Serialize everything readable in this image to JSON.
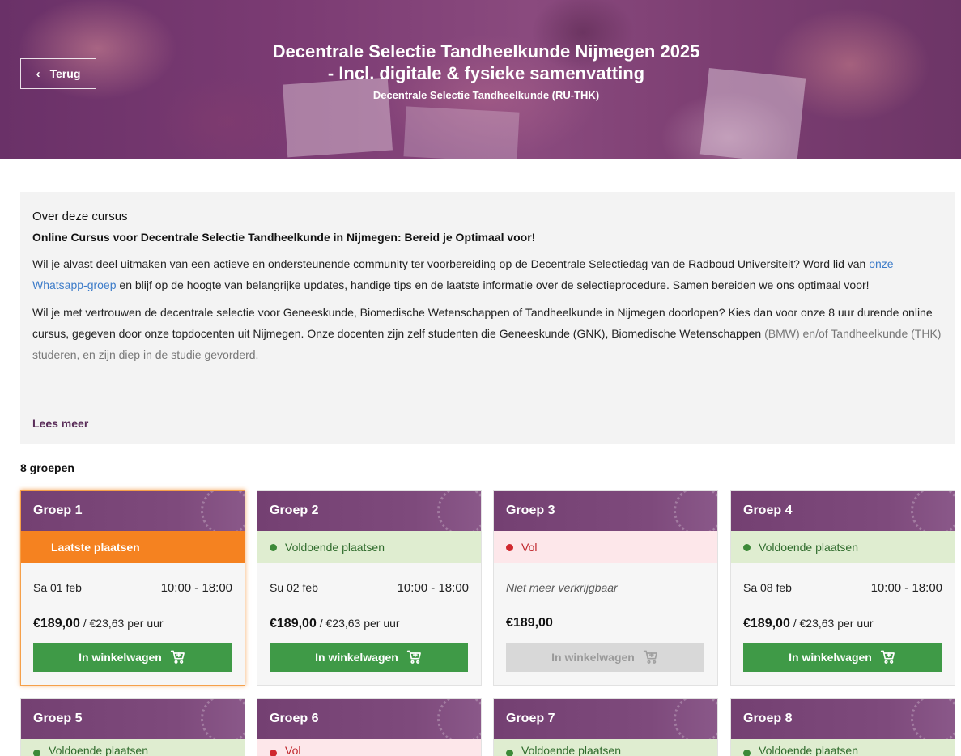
{
  "header": {
    "back_label": "Terug",
    "title_line1": "Decentrale Selectie Tandheelkunde Nijmegen 2025",
    "title_line2": "- Incl. digitale & fysieke samenvatting",
    "subtitle": "Decentrale Selectie Tandheelkunde (RU-THK)"
  },
  "about": {
    "heading": "Over deze cursus",
    "subheading": "Online Cursus voor Decentrale Selectie Tandheelkunde in Nijmegen: Bereid je Optimaal voor!",
    "p1_before": "Wil je alvast deel uitmaken van een actieve en ondersteunende community ter voorbereiding op de Decentrale Selectiedag van de Radboud Universiteit? Word lid van ",
    "p1_link": "onze Whatsapp-groep",
    "p1_after": " en blijf op de hoogte van belangrijke updates, handige tips en de laatste informatie over de selectieprocedure. Samen bereiden we ons optimaal voor!",
    "p2_main": "Wil je met vertrouwen de decentrale selectie voor Geneeskunde, Biomedische Wetenschappen of Tandheelkunde in Nijmegen doorlopen? Kies dan voor onze 8 uur durende online cursus, gegeven door onze topdocenten uit Nijmegen. Onze docenten zijn zelf studenten die Geneeskunde (GNK), Biomedische Wetenschappen ",
    "p2_faded": "(BMW) en/of Tandheelkunde (THK) studeren, en zijn diep in de studie gevorderd.",
    "read_more": "Lees meer"
  },
  "group_count": "8 groepen",
  "cart_label": "In winkelwagen",
  "groups": [
    {
      "title": "Groep 1",
      "status": "Laatste plaatsen",
      "date": "Sa 01 feb",
      "time": "10:00 - 18:00",
      "price": "€189,00",
      "per_hour": " / €23,63 per uur"
    },
    {
      "title": "Groep 2",
      "status": "Voldoende plaatsen",
      "date": "Su 02 feb",
      "time": "10:00 - 18:00",
      "price": "€189,00",
      "per_hour": " / €23,63 per uur"
    },
    {
      "title": "Groep 3",
      "status": "Vol",
      "unavailable": "Niet meer verkrijgbaar",
      "price": "€189,00"
    },
    {
      "title": "Groep 4",
      "status": "Voldoende plaatsen",
      "date": "Sa 08 feb",
      "time": "10:00 - 18:00",
      "price": "€189,00",
      "per_hour": " / €23,63 per uur"
    },
    {
      "title": "Groep 5",
      "status": "Voldoende plaatsen"
    },
    {
      "title": "Groep 6",
      "status": "Vol"
    },
    {
      "title": "Groep 7",
      "status": "Voldoende plaatsen"
    },
    {
      "title": "Groep 8",
      "status": "Voldoende plaatsen"
    }
  ],
  "colors": {
    "brand_purple": "#7a4678",
    "cart_green": "#3f9a47",
    "status_last": "#f58220",
    "status_ok_bg": "#dfedd0",
    "status_full_bg": "#fde7ea",
    "link_blue": "#3d7cc9"
  }
}
